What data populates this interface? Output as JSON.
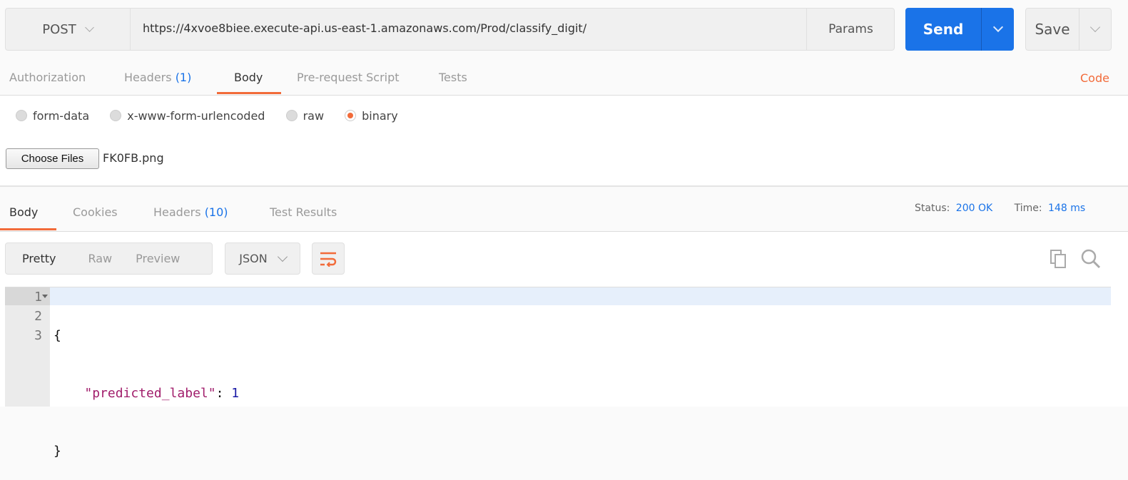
{
  "request": {
    "method": "POST",
    "url": "https://4xvoe8biee.execute-api.us-east-1.amazonaws.com/Prod/classify_digit/",
    "params_label": "Params",
    "send_label": "Send",
    "save_label": "Save"
  },
  "request_tabs": [
    {
      "label": "Authorization"
    },
    {
      "label": "Headers",
      "count": "(1)"
    },
    {
      "label": "Body"
    },
    {
      "label": "Pre-request Script"
    },
    {
      "label": "Tests"
    }
  ],
  "code_link": "Code",
  "body_modes": [
    {
      "label": "form-data"
    },
    {
      "label": "x-www-form-urlencoded"
    },
    {
      "label": "raw"
    },
    {
      "label": "binary",
      "selected": true
    }
  ],
  "file": {
    "button": "Choose Files",
    "name": "FK0FB.png"
  },
  "response_tabs": [
    {
      "label": "Body"
    },
    {
      "label": "Cookies"
    },
    {
      "label": "Headers",
      "count": "(10)"
    },
    {
      "label": "Test Results"
    }
  ],
  "status": {
    "status_label": "Status:",
    "status_value": "200 OK",
    "time_label": "Time:",
    "time_value": "148 ms"
  },
  "view_modes": [
    {
      "label": "Pretty"
    },
    {
      "label": "Raw"
    },
    {
      "label": "Preview"
    }
  ],
  "format": "JSON",
  "editor": {
    "line_numbers": [
      "1",
      "2",
      "3"
    ],
    "open": "{",
    "key": "\"predicted_label\"",
    "colon": ": ",
    "value": "1",
    "close": "}"
  },
  "colors": {
    "accent": "#f26b3a",
    "send": "#1a73e8",
    "key": "#a11d6b",
    "number": "#1a1aa6"
  }
}
